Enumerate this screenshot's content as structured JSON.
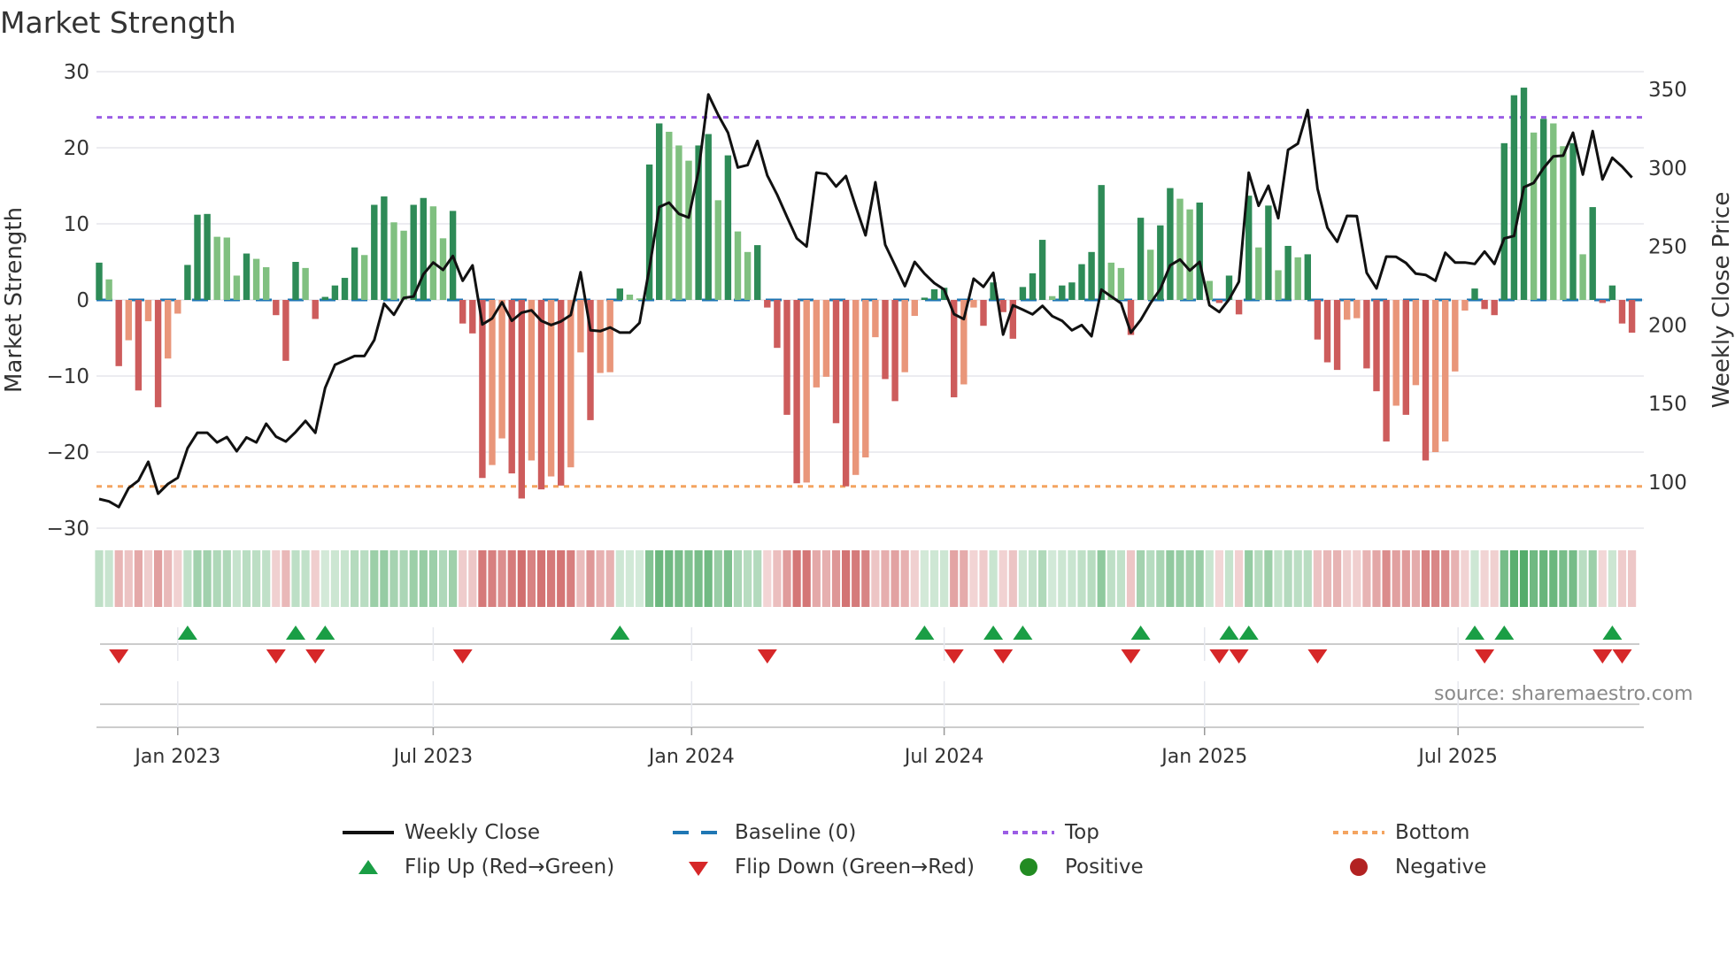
{
  "title": "Market Strength",
  "source": "source: sharemaestro.com",
  "colors": {
    "strong_green": "#2e8b57",
    "weak_green": "#80c080",
    "strong_red": "#cd5c5c",
    "weak_red": "#e9967a",
    "baseline": "#1f77b4",
    "top": "#9b5de5",
    "bottom": "#f4a460",
    "close": "#111111",
    "flip_up": "#1a9e45",
    "flip_down": "#d62728",
    "positive": "#228b22",
    "negative": "#b22222"
  },
  "legend": {
    "weekly_close": "Weekly Close",
    "baseline": "Baseline (0)",
    "top": "Top",
    "bottom": "Bottom",
    "flip_up": "Flip Up (Red→Green)",
    "flip_down": "Flip Down (Green→Red)",
    "positive": "Positive",
    "negative": "Negative"
  },
  "chart_data": {
    "type": "bar",
    "title": "Market Strength",
    "ylabel": "Market Strength",
    "y2label": "Weekly Close Price",
    "ylim": [
      -30,
      30
    ],
    "yticks": [
      30,
      20,
      10,
      0,
      -10,
      -20,
      -30
    ],
    "ytick_labels": [
      "30",
      "20",
      "10",
      "0",
      "−10",
      "−20",
      "−30"
    ],
    "y2lim": [
      100,
      350
    ],
    "y2ticks": [
      350,
      300,
      250,
      200,
      150,
      100
    ],
    "y2tick_labels": [
      "350",
      "300",
      "250",
      "200",
      "150",
      "100"
    ],
    "x_unit": "week index",
    "xticks": [
      {
        "week": 8.0,
        "label": "Jan 2023"
      },
      {
        "week": 34.0,
        "label": "Jul 2023"
      },
      {
        "week": 60.3,
        "label": "Jan 2024"
      },
      {
        "week": 86.0,
        "label": "Jul 2024"
      },
      {
        "week": 112.5,
        "label": "Jan 2025"
      },
      {
        "week": 138.3,
        "label": "Jul 2025"
      }
    ],
    "top_level": 24,
    "bottom_level": -24.5,
    "baseline": 0,
    "series": [
      {
        "name": "Market Strength",
        "type": "bar",
        "values": [
          4.9,
          2.7,
          -8.7,
          -5.3,
          -11.9,
          -2.8,
          -14.1,
          -7.7,
          -1.8,
          4.6,
          11.2,
          11.3,
          8.3,
          8.2,
          3.2,
          6.1,
          5.4,
          4.3,
          -2.0,
          -8.0,
          5.0,
          4.2,
          -2.5,
          0.4,
          1.9,
          2.9,
          6.9,
          5.9,
          12.5,
          13.6,
          10.2,
          9.1,
          12.5,
          13.4,
          12.3,
          8.1,
          11.7,
          -3.1,
          -4.4,
          -23.4,
          -21.7,
          -18.2,
          -22.8,
          -26.1,
          -21.1,
          -24.9,
          -23.2,
          -24.4,
          -22.0,
          -6.9,
          -15.8,
          -9.6,
          -9.5,
          1.5,
          0.7,
          0.2,
          17.8,
          23.2,
          22.1,
          20.3,
          18.3,
          20.3,
          21.8,
          13.1,
          19.0,
          9.0,
          6.3,
          7.2,
          -1.0,
          -6.3,
          -15.1,
          -24.1,
          -24.0,
          -11.5,
          -10.1,
          -16.2,
          -24.5,
          -23.0,
          -20.7,
          -4.9,
          -10.4,
          -13.3,
          -9.5,
          -2.1,
          0.3,
          1.4,
          1.6,
          -12.8,
          -11.1,
          -1.0,
          -3.4,
          2.3,
          -1.6,
          -5.1,
          1.7,
          3.5,
          7.9,
          0.5,
          1.9,
          2.3,
          4.7,
          6.3,
          15.1,
          4.9,
          4.2,
          -4.6,
          10.8,
          6.6,
          9.8,
          14.7,
          13.3,
          11.9,
          12.8,
          2.5,
          -0.4,
          3.2,
          -1.9,
          13.7,
          6.9,
          12.4,
          3.9,
          7.1,
          5.6,
          6.0,
          -5.2,
          -8.2,
          -9.2,
          -2.6,
          -2.4,
          -9.0,
          -12.0,
          -18.6,
          -13.9,
          -15.1,
          -11.2,
          -21.1,
          -20.0,
          -18.6,
          -9.4,
          -1.4,
          1.5,
          -1.2,
          -2.0,
          20.6,
          26.9,
          27.9,
          22.0,
          23.8,
          23.2,
          20.2,
          20.6,
          6.0,
          12.2,
          -0.4,
          1.9,
          -3.1,
          -4.3
        ]
      },
      {
        "name": "Weekly Close",
        "type": "line",
        "axis": "right",
        "values": [
          89.3,
          87.8,
          84.2,
          96.2,
          101,
          113,
          92.7,
          98.9,
          102.8,
          121.6,
          131.5,
          131.5,
          125.3,
          128.7,
          119.7,
          128.5,
          125.3,
          137.2,
          129,
          125.9,
          131.9,
          139,
          131.4,
          160,
          174.7,
          177.5,
          180.3,
          180.3,
          190.5,
          213.6,
          206.6,
          217.3,
          218.2,
          232.3,
          239.8,
          235.1,
          244,
          228.2,
          238,
          200.4,
          204.2,
          214.5,
          202.7,
          207.9,
          209.4,
          202.7,
          200,
          202.3,
          206.4,
          233.6,
          196.7,
          196.1,
          198.5,
          195.2,
          195.2,
          201.4,
          236.1,
          275.1,
          277.9,
          270.8,
          268.4,
          298,
          346.8,
          333.7,
          322.4,
          300.3,
          301.8,
          317.2,
          295.2,
          283,
          268.9,
          255.2,
          250,
          297,
          296.1,
          288.2,
          294.8,
          275.5,
          257.1,
          290.9,
          251.1,
          238,
          224.8,
          240.2,
          232.7,
          226.7,
          222.6,
          207,
          203.8,
          229.5,
          224.3,
          233.3,
          193.9,
          212.6,
          209.8,
          206.8,
          212.2,
          205.7,
          202.7,
          196.7,
          200,
          192.9,
          222.6,
          218.2,
          213.9,
          195.2,
          203.2,
          213.9,
          222.9,
          238,
          241.7,
          234.7,
          240.2,
          212.6,
          208.3,
          216.4,
          227.6,
          297,
          275.9,
          288.6,
          268,
          311.5,
          315.5,
          336.9,
          286.8,
          262,
          253,
          269.5,
          269.3,
          233.3,
          223.3,
          243.6,
          243.4,
          239.5,
          232.7,
          231.9,
          228.2,
          246,
          239.8,
          239.8,
          238.9,
          246.8,
          238.9,
          255.2,
          256.7,
          287.7,
          290.5,
          299.9,
          307.4,
          307.8,
          322.4,
          295.8,
          323.4,
          292.7,
          306.5,
          300.8,
          293.9
        ]
      }
    ],
    "legend_position": "bottom"
  }
}
